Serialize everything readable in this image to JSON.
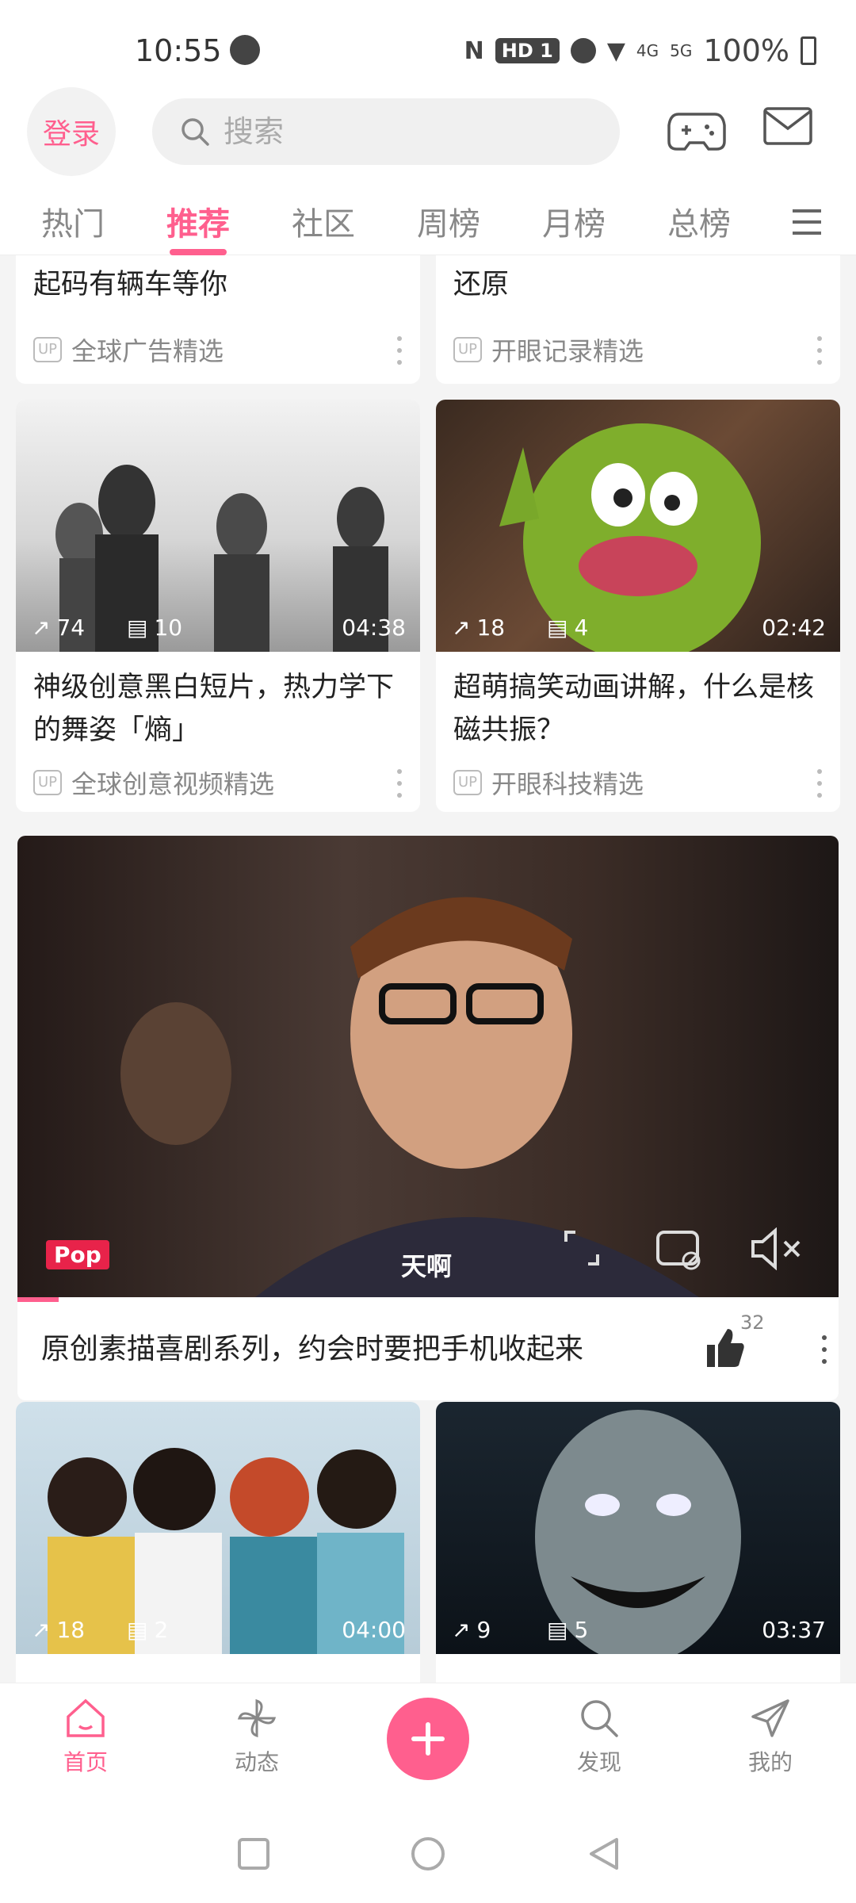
{
  "status_bar": {
    "time": "10:55",
    "hd": "HD 1",
    "net1": "4G",
    "net2": "5G",
    "battery": "100%"
  },
  "header": {
    "login_label": "登录",
    "search_placeholder": "搜索"
  },
  "tabs": [
    {
      "label": "热门",
      "active": false
    },
    {
      "label": "推荐",
      "active": true
    },
    {
      "label": "社区",
      "active": false
    },
    {
      "label": "周榜",
      "active": false
    },
    {
      "label": "月榜",
      "active": false
    },
    {
      "label": "总榜",
      "active": false
    }
  ],
  "cards_top": [
    {
      "title": "韩国广告：如果还不择加班，起码有辆车等你",
      "title_visible": "起码有辆车等你",
      "up": "全球广告精选",
      "up_badge": "UP"
    },
    {
      "title": "史前记录：全网最逼真的恐龙还原",
      "title_visible": "还原",
      "up": "开眼记录精选",
      "up_badge": "UP"
    }
  ],
  "cards_mid": [
    {
      "shares": "74",
      "comments": "10",
      "duration": "04:38",
      "title": "神级创意黑白短片，热力学下的舞姿「熵」",
      "up": "全球创意视频精选",
      "up_badge": "UP"
    },
    {
      "shares": "18",
      "comments": "4",
      "duration": "02:42",
      "title": "超萌搞笑动画讲解，什么是核磁共振？",
      "up": "开眼科技精选",
      "up_badge": "UP"
    }
  ],
  "featured": {
    "subtitle": "天啊",
    "brand": "Pop",
    "title": "原创素描喜剧系列，约会时要把手机收起来",
    "likes": "32",
    "progress": 0.05
  },
  "cards_bottom": [
    {
      "shares": "18",
      "comments": "2",
      "duration": "04:00"
    },
    {
      "shares": "9",
      "comments": "5",
      "duration": "03:37"
    }
  ],
  "bottom_nav": [
    {
      "label": "首页",
      "icon": "home-icon",
      "active": true
    },
    {
      "label": "动态",
      "icon": "pinwheel-icon",
      "active": false
    },
    {
      "label": "",
      "icon": "plus-icon",
      "active": false
    },
    {
      "label": "发现",
      "icon": "search-icon",
      "active": false
    },
    {
      "label": "我的",
      "icon": "send-icon",
      "active": false
    }
  ],
  "colors": {
    "accent": "#ff5f8e",
    "background": "#f4f4f4"
  }
}
